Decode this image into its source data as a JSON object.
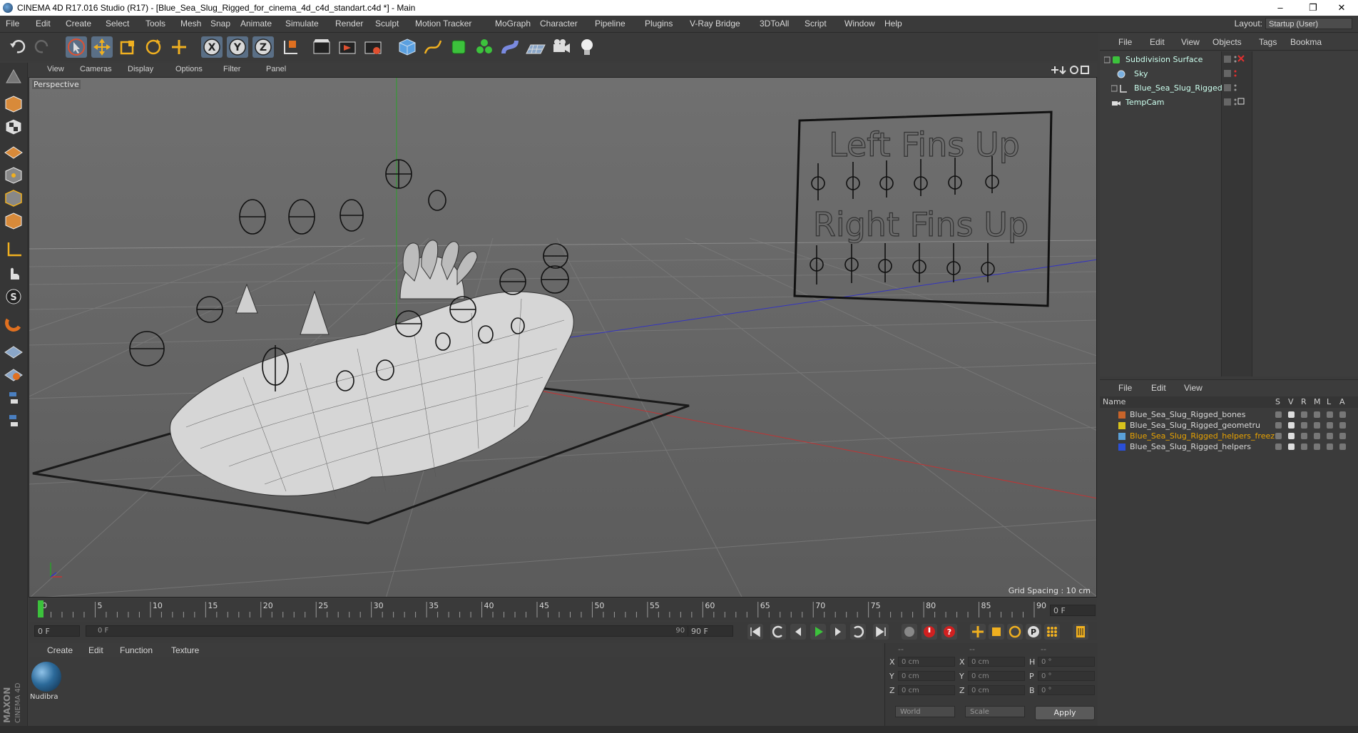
{
  "window": {
    "title": "CINEMA 4D R17.016 Studio (R17) - [Blue_Sea_Slug_Rigged_for_cinema_4d_c4d_standart.c4d *] - Main",
    "minimize": "–",
    "maximize": "❐",
    "close": "✕"
  },
  "menubar": {
    "items": [
      "File",
      "Edit",
      "Create",
      "Select",
      "Tools",
      "Mesh",
      "Snap",
      "Animate",
      "Simulate",
      "Render",
      "Sculpt",
      "Motion Tracker",
      "MoGraph",
      "Character",
      "Pipeline",
      "Plugins",
      "V-Ray Bridge",
      "3DToAll",
      "Script",
      "Window",
      "Help"
    ],
    "layout_label": "Layout:",
    "layout_value": "Startup (User)"
  },
  "viewport": {
    "menu": [
      "View",
      "Cameras",
      "Display",
      "Options",
      "Filter",
      "Panel"
    ],
    "label": "Perspective",
    "grid_spacing": "Grid Spacing : 10 cm",
    "board_top": "Left Fins Up",
    "board_bottom": "Right Fins Up"
  },
  "timeline": {
    "ticks": [
      "0",
      "5",
      "10",
      "15",
      "20",
      "25",
      "30",
      "35",
      "40",
      "45",
      "50",
      "55",
      "60",
      "65",
      "70",
      "75",
      "80",
      "85",
      "90"
    ],
    "current_frame": "0 F",
    "start_field": "0 F",
    "range_start": "0 F",
    "range_end": "90 F",
    "end_field": "90 F",
    "max_frames": 90
  },
  "materials": {
    "menu": [
      "Create",
      "Edit",
      "Function",
      "Texture"
    ],
    "items": [
      {
        "name": "Nudibra"
      }
    ]
  },
  "coordinates": {
    "header": [
      "--",
      "--",
      "--"
    ],
    "rows": [
      {
        "a": "X",
        "av": "0 cm",
        "b": "X",
        "bv": "0 cm",
        "c": "H",
        "cv": "0 °"
      },
      {
        "a": "Y",
        "av": "0 cm",
        "b": "Y",
        "bv": "0 cm",
        "c": "P",
        "cv": "0 °"
      },
      {
        "a": "Z",
        "av": "0 cm",
        "b": "Z",
        "bv": "0 cm",
        "c": "B",
        "cv": "0 °"
      }
    ],
    "mode": "World",
    "scale": "Scale",
    "apply": "Apply"
  },
  "object_manager": {
    "menu": [
      "File",
      "Edit",
      "View",
      "Objects",
      "Tags",
      "Bookma"
    ],
    "objects": [
      {
        "name": "Subdivision Surface",
        "indent": 0
      },
      {
        "name": "Sky",
        "indent": 1
      },
      {
        "name": "Blue_Sea_Slug_Rigged",
        "indent": 1
      },
      {
        "name": "TempCam",
        "indent": 0
      }
    ]
  },
  "layer_manager": {
    "menu": [
      "File",
      "Edit",
      "View"
    ],
    "columns": [
      "Name",
      "S",
      "V",
      "R",
      "M",
      "L",
      "A"
    ],
    "layers": [
      {
        "name": "Blue_Sea_Slug_Rigged_bones",
        "color": "#c8642a",
        "highlight": false
      },
      {
        "name": "Blue_Sea_Slug_Rigged_geometru",
        "color": "#d8c21c",
        "highlight": false
      },
      {
        "name": "Blue_Sea_Slug_Rigged_helpers_freez",
        "color": "#5aa0d8",
        "highlight": true
      },
      {
        "name": "Blue_Sea_Slug_Rigged_helpers",
        "color": "#2a4fd8",
        "highlight": false
      }
    ]
  },
  "branding": {
    "maxon": "MAXON",
    "cinema": "CINEMA 4D"
  },
  "colors": {
    "accent": "#5a6f86",
    "highlight_text": "#e8a200",
    "play": "#3cc23c"
  }
}
